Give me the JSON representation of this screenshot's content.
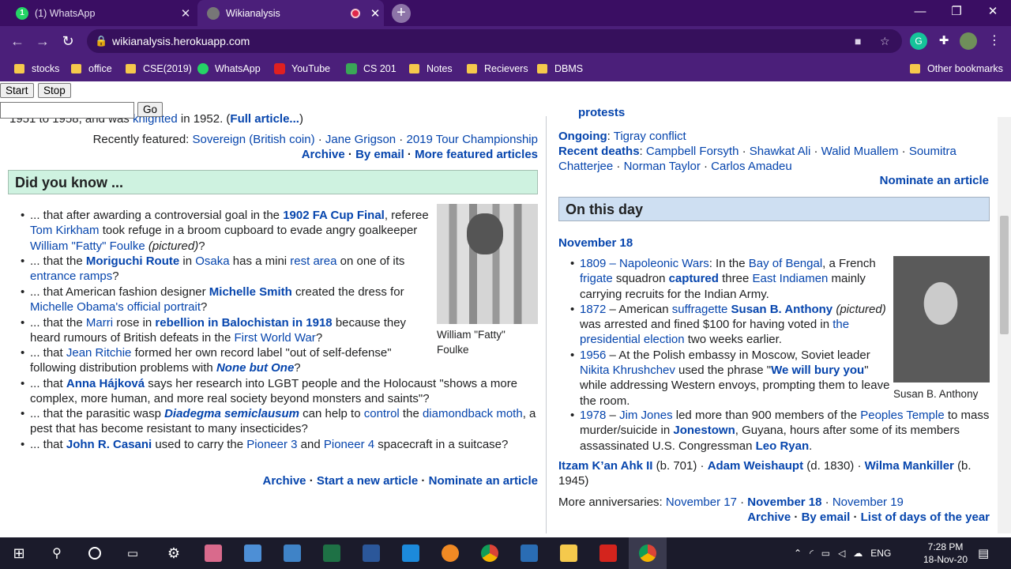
{
  "browser": {
    "tabs": [
      {
        "title": "(1) WhatsApp"
      },
      {
        "title": "Wikianalysis"
      }
    ],
    "url": "wikianalysis.herokuapp.com",
    "bookmarks": [
      "stocks",
      "office",
      "CSE(2019)",
      "WhatsApp",
      "YouTube",
      "CS 201",
      "Notes",
      "Recievers",
      "DBMS"
    ],
    "other_bookmarks": "Other bookmarks"
  },
  "controls": {
    "start": "Start",
    "stop": "Stop",
    "go": "Go"
  },
  "left": {
    "top_line_a": "1951 to 1958, and was",
    "top_line_link": "knighted",
    "top_line_b": "in 1952. (",
    "full_article": "Full article...",
    "top_line_c": ")",
    "recent_label": "Recently featured:",
    "recent_items": [
      "Sovereign (British coin)",
      "Jane Grigson",
      "2019 Tour Championship"
    ],
    "archive": "Archive",
    "by_email": "By email",
    "more_featured": "More featured articles",
    "dyk_title": "Did you know ...",
    "dyk_caption": "William \"Fatty\" Foulke",
    "footer": {
      "archive": "Archive",
      "start": "Start a new article",
      "nominate": "Nominate an article"
    }
  },
  "right": {
    "protests": "protests",
    "ongoing_label": "Ongoing",
    "ongoing_item": "Tigray conflict",
    "recent_deaths_label": "Recent deaths",
    "recent_deaths": [
      "Campbell Forsyth",
      "Shawkat Ali",
      "Walid Muallem",
      "Soumitra Chatterjee",
      "Norman Taylor",
      "Carlos Amadeu"
    ],
    "nominate": "Nominate an article",
    "otd_title": "On this day",
    "date": "November 18",
    "caption": "Susan B. Anthony",
    "births_a": "Itzam K’an Ahk II",
    "births_a_note": "(b. 701)",
    "births_b": "Adam Weishaupt",
    "births_b_note": "(d. 1830)",
    "births_c": "Wilma Mankiller",
    "births_c_note": "(b. 1945)",
    "more_label": "More anniversaries:",
    "more_items": [
      "November 17",
      "November 18",
      "November 19"
    ],
    "footer": {
      "archive": "Archive",
      "by_email": "By email",
      "list": "List of days of the year"
    }
  },
  "taskbar": {
    "lang": "ENG",
    "time": "7:28 PM",
    "date": "18-Nov-20"
  }
}
